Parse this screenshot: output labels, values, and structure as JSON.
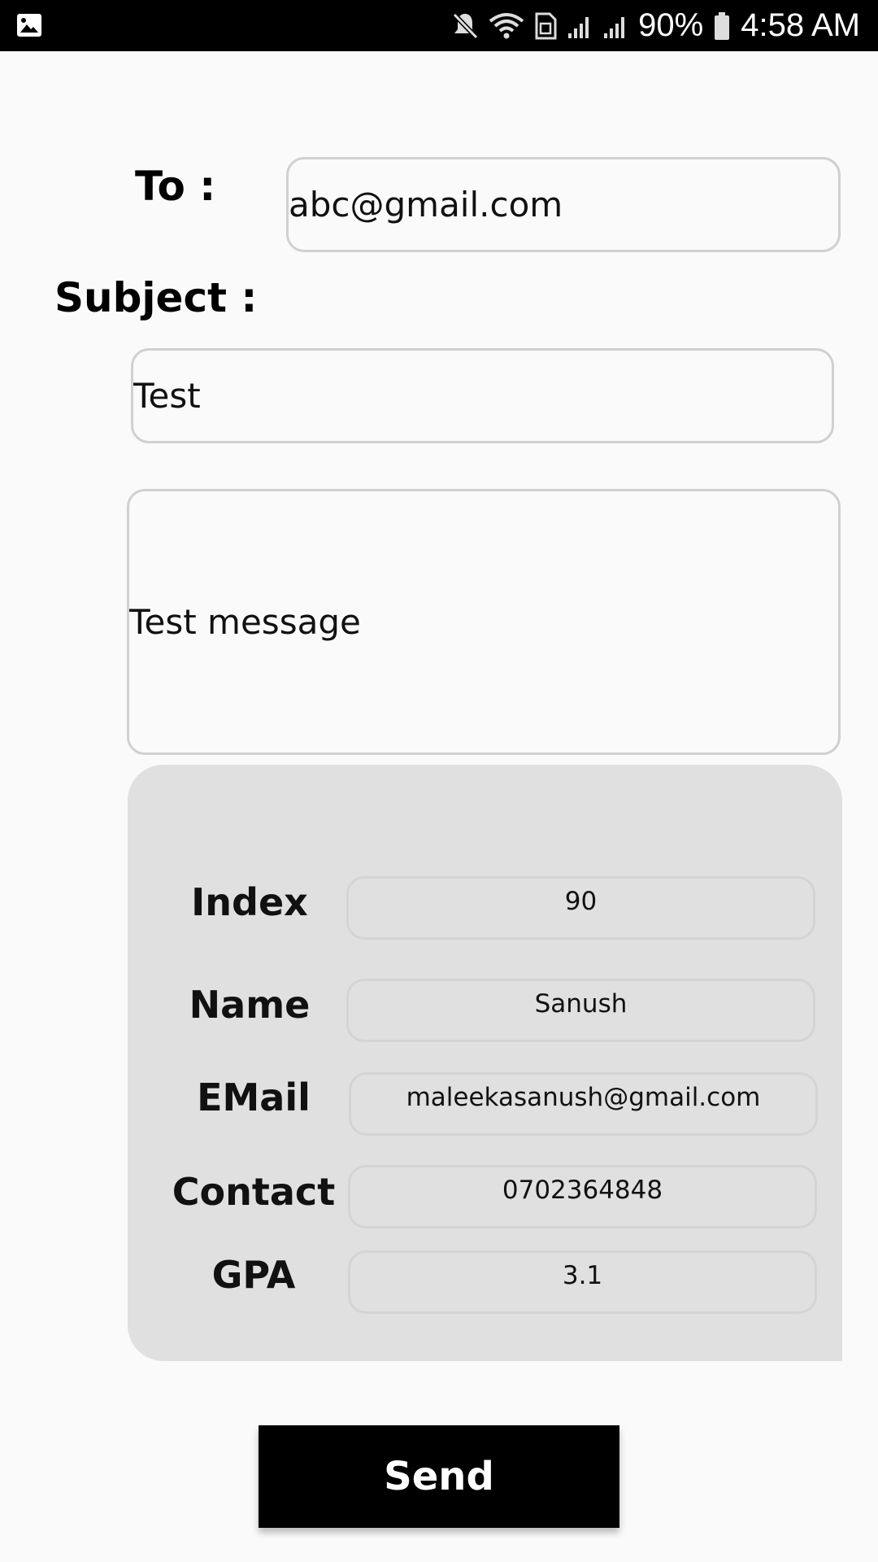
{
  "status_bar": {
    "battery": "90%",
    "time": "4:58 AM",
    "icons": [
      "gallery-icon",
      "mute-icon",
      "wifi-icon",
      "sim-icon",
      "signal-icon",
      "signal-icon",
      "battery-icon"
    ]
  },
  "form": {
    "to_label": "To :",
    "to_value": "abc@gmail.com",
    "subject_label": "Subject :",
    "subject_value": "Test",
    "message_value": "Test message"
  },
  "student_card": {
    "rows": [
      {
        "label": "Index",
        "value": "90"
      },
      {
        "label": "Name",
        "value": "Sanush"
      },
      {
        "label": "EMail",
        "value": "maleekasanush@gmail.com"
      },
      {
        "label": "Contact",
        "value": "0702364848"
      },
      {
        "label": "GPA",
        "value": "3.1"
      }
    ]
  },
  "send_button": {
    "label": "Send"
  },
  "colors": {
    "background": "#fafafa",
    "status_bar": "#000000",
    "card": "#e0e0e0",
    "field_border": "#d0d0d0",
    "button": "#000000",
    "button_text": "#ffffff"
  }
}
